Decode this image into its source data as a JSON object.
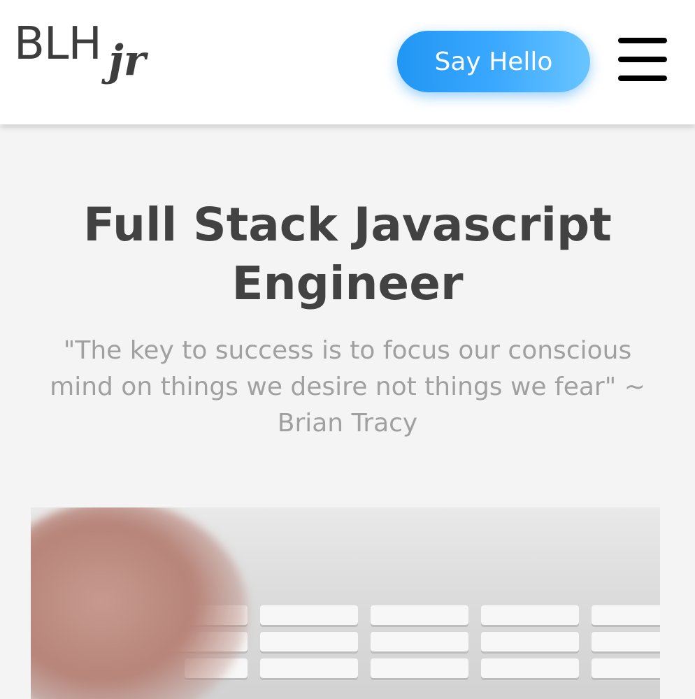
{
  "header": {
    "logo_main": "BLH",
    "logo_suffix": "jr",
    "say_hello_label": "Say Hello",
    "menu_icon": "hamburger-menu-icon",
    "accent_gradient": [
      "#2196f3",
      "#69c5ff"
    ]
  },
  "hero": {
    "title": "Full Stack Javascript Engineer",
    "quote": "\"The key to success is to focus our conscious mind on things we desire not things we fear\" ~ Brian Tracy",
    "image": "keyboard-typing-photo"
  }
}
